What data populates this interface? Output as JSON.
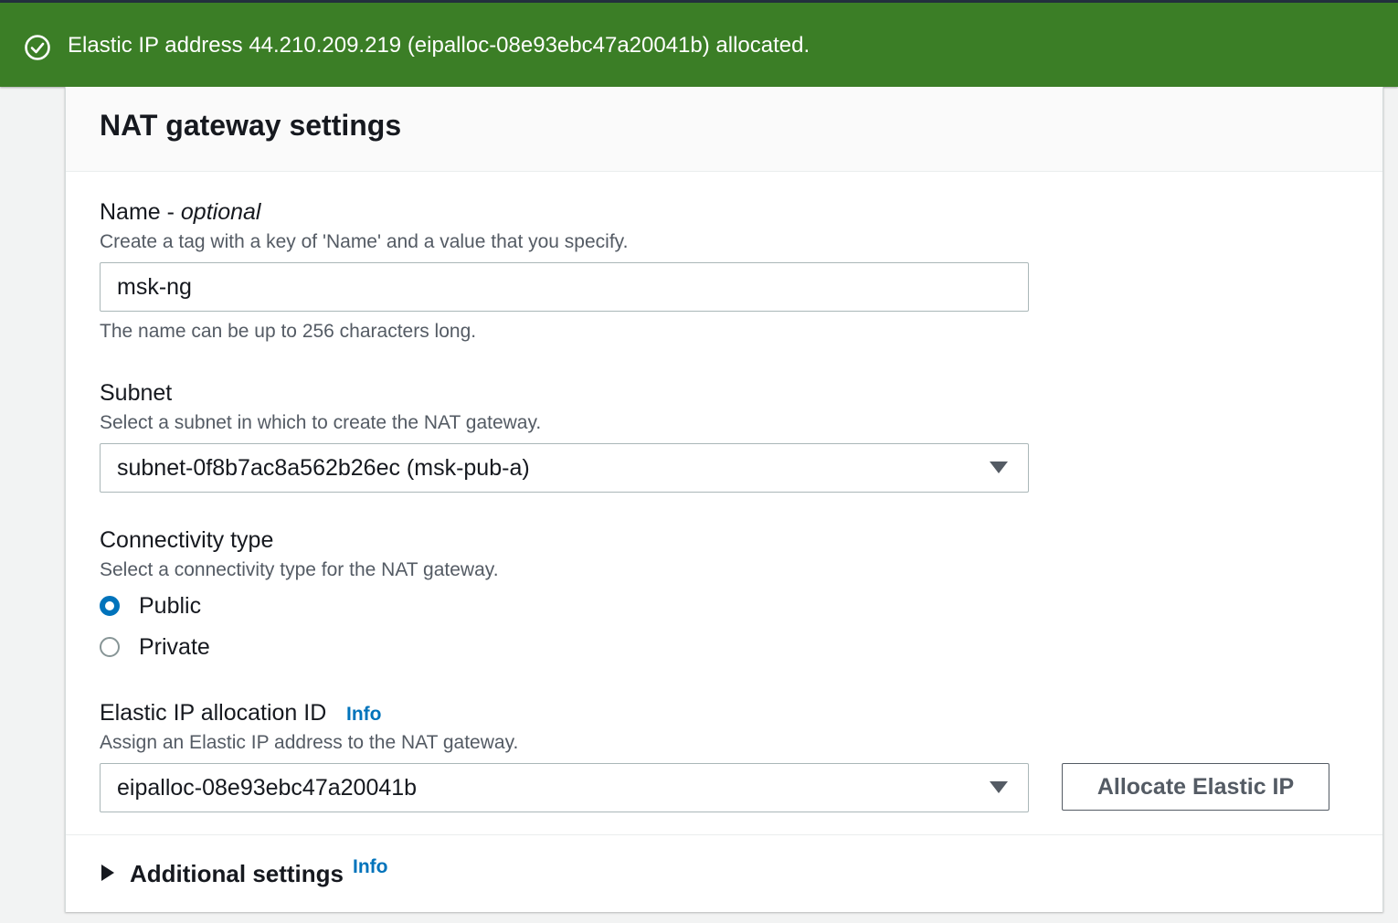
{
  "flash": {
    "message": "Elastic IP address 44.210.209.219 (eipalloc-08e93ebc47a20041b) allocated.",
    "color": "#3b7e26",
    "icon": "check-circle-icon"
  },
  "panel": {
    "title": "NAT gateway settings"
  },
  "name_field": {
    "label": "Name - ",
    "label_optional": "optional",
    "description": "Create a tag with a key of 'Name' and a value that you specify.",
    "value": "msk-ng",
    "constraint": "The name can be up to 256 characters long."
  },
  "subnet_field": {
    "label": "Subnet",
    "description": "Select a subnet in which to create the NAT gateway.",
    "selected": "subnet-0f8b7ac8a562b26ec (msk-pub-a)"
  },
  "connectivity": {
    "label": "Connectivity type",
    "description": "Select a connectivity type for the NAT gateway.",
    "options": [
      {
        "label": "Public",
        "checked": true
      },
      {
        "label": "Private",
        "checked": false
      }
    ]
  },
  "elastic_ip": {
    "label": "Elastic IP allocation ID",
    "info": "Info",
    "description": "Assign an Elastic IP address to the NAT gateway.",
    "selected": "eipalloc-08e93ebc47a20041b",
    "allocate_button": "Allocate Elastic IP"
  },
  "additional_settings": {
    "label": "Additional settings",
    "info": "Info"
  },
  "colors": {
    "link": "#0073bb",
    "radio_selected": "#0073bb"
  }
}
